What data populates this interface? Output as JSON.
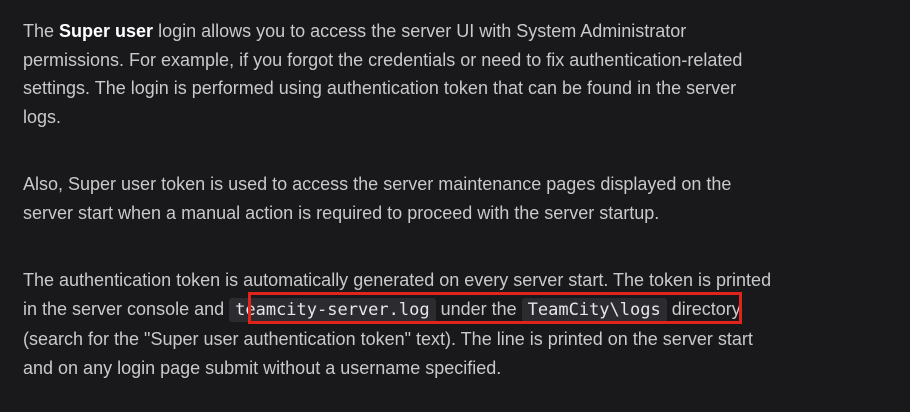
{
  "paragraph1": {
    "line1_a": "The ",
    "line1_bold": "Super user",
    "line1_b": " login allows you to access the server UI with System Administrator",
    "line2": "permissions. For example, if you forgot the credentials or need to fix authentication-related",
    "line3": "settings. The login is performed using authentication token that can be found in the server",
    "line4": "logs."
  },
  "paragraph2": {
    "line1": "Also, Super user token is used to access the server maintenance pages displayed on the",
    "line2": "server start when a manual action is required to proceed with the server startup."
  },
  "paragraph3": {
    "line1": "The authentication token is automatically generated on every server start. The token is printed",
    "line2_a": "in the server console and ",
    "code_log_file": "teamcity-server.log",
    "line2_b": " under the ",
    "code_log_dir": "TeamCity\\logs",
    "line2_c": " directory",
    "line3": "(search for the \"Super user authentication token\" text). The line is printed on the server start",
    "line4": "and on any login page submit without a username specified."
  },
  "highlight_color": "#e0241a"
}
